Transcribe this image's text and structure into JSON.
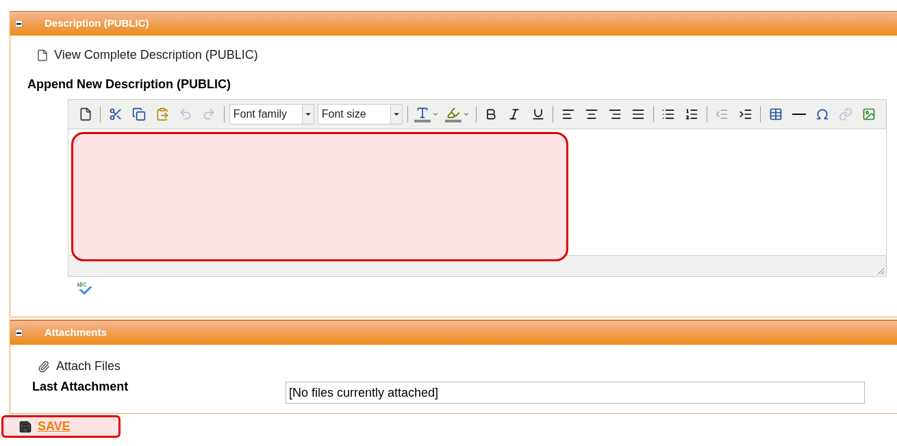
{
  "description_panel": {
    "title": "Description (PUBLIC)",
    "expanded": true,
    "view_link": "View Complete Description (PUBLIC)",
    "append_label": "Append New Description (PUBLIC)",
    "toolbar": [
      {
        "kind": "button",
        "disabled": false
      },
      {
        "kind": "separator"
      },
      {
        "kind": "button",
        "disabled": false
      },
      {
        "kind": "button",
        "disabled": false
      },
      {
        "kind": "button",
        "disabled": false
      },
      {
        "kind": "button",
        "disabled": true
      },
      {
        "kind": "button",
        "disabled": true
      },
      {
        "kind": "separator"
      },
      {
        "kind": "select",
        "value": "Font family"
      },
      {
        "kind": "select",
        "value": "Font size"
      },
      {
        "kind": "separator"
      },
      {
        "kind": "split",
        "disabled": false
      },
      {
        "kind": "split",
        "disabled": false
      },
      {
        "kind": "separator"
      },
      {
        "kind": "button",
        "disabled": false
      },
      {
        "kind": "button",
        "disabled": false
      },
      {
        "kind": "button",
        "disabled": false
      },
      {
        "kind": "separator"
      },
      {
        "kind": "button",
        "disabled": false
      },
      {
        "kind": "button",
        "disabled": false
      },
      {
        "kind": "button",
        "disabled": false
      },
      {
        "kind": "button",
        "disabled": false
      },
      {
        "kind": "separator"
      },
      {
        "kind": "button",
        "disabled": false
      },
      {
        "kind": "button",
        "disabled": false
      },
      {
        "kind": "separator"
      },
      {
        "kind": "button",
        "disabled": true
      },
      {
        "kind": "button",
        "disabled": false
      },
      {
        "kind": "separator"
      },
      {
        "kind": "button",
        "disabled": false
      },
      {
        "kind": "button",
        "disabled": false
      },
      {
        "kind": "button",
        "disabled": false
      },
      {
        "kind": "button",
        "disabled": true
      },
      {
        "kind": "button",
        "disabled": false
      }
    ],
    "editor_highlighted": true
  },
  "attachments_panel": {
    "title": "Attachments",
    "expanded": true,
    "attach_link": "Attach Files",
    "last_attachment_label": "Last Attachment",
    "last_attachment_value": "[No files currently attached]"
  },
  "save": {
    "label": "SAVE",
    "highlighted": true
  }
}
